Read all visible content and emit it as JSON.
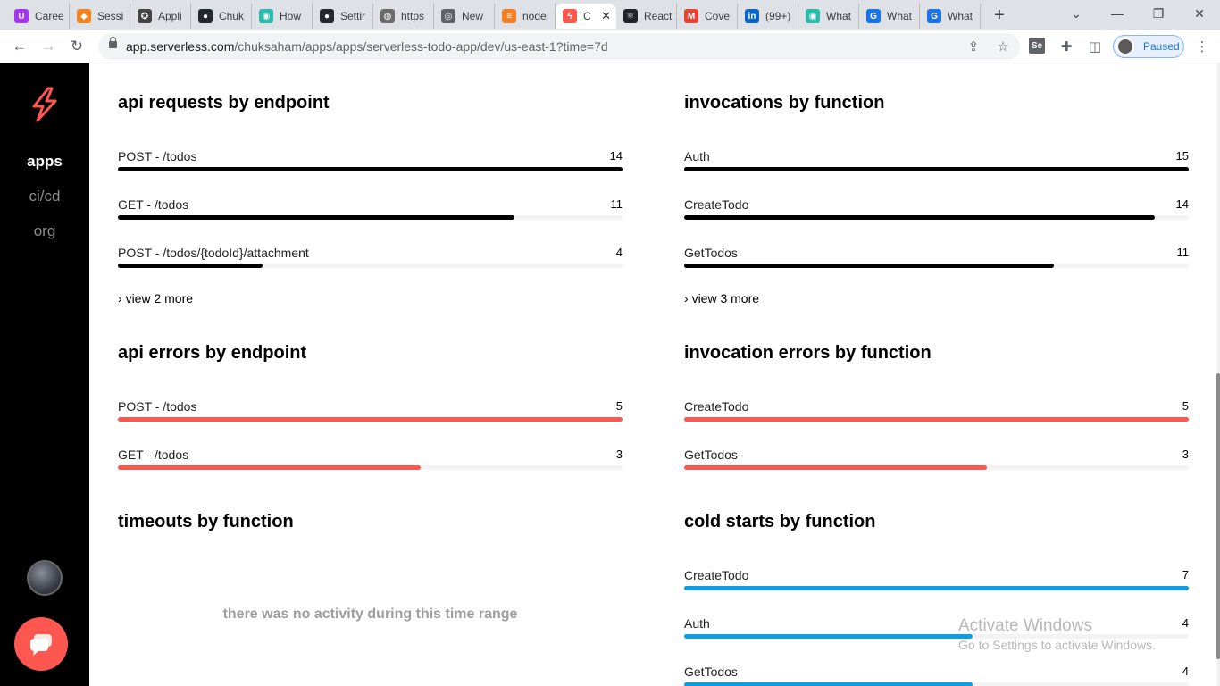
{
  "browser": {
    "tabs": [
      {
        "title": "Caree",
        "icon": "udemy-icon",
        "color": "#a435f0",
        "glyph": "U"
      },
      {
        "title": "Sessi",
        "icon": "package-icon",
        "color": "#f5821f",
        "glyph": "◆"
      },
      {
        "title": "Appli",
        "icon": "shield-app-icon",
        "color": "#444444",
        "glyph": "✪"
      },
      {
        "title": "Chuk",
        "icon": "github-icon",
        "color": "#24292e",
        "glyph": "●"
      },
      {
        "title": "How",
        "icon": "eye-icon",
        "color": "#2bbbad",
        "glyph": "◉"
      },
      {
        "title": "Settir",
        "icon": "github-icon",
        "color": "#24292e",
        "glyph": "●"
      },
      {
        "title": "https",
        "icon": "globe-icon",
        "color": "#6b6b6b",
        "glyph": "◍"
      },
      {
        "title": "New",
        "icon": "chrome-icon",
        "color": "#5f6368",
        "glyph": "◎"
      },
      {
        "title": "node",
        "icon": "stackoverflow-icon",
        "color": "#f48024",
        "glyph": "≡"
      },
      {
        "title": "C",
        "icon": "serverless-icon",
        "color": "#fd5750",
        "glyph": "ϟ",
        "active": true
      },
      {
        "title": "React",
        "icon": "react-icon",
        "color": "#20232a",
        "glyph": "⚛"
      },
      {
        "title": "Cove",
        "icon": "gmail-icon",
        "color": "#ea4335",
        "glyph": "M"
      },
      {
        "title": "(99+)",
        "icon": "linkedin-icon",
        "color": "#0a66c2",
        "glyph": "in"
      },
      {
        "title": "What",
        "icon": "eye-icon",
        "color": "#2bbbad",
        "glyph": "◉"
      },
      {
        "title": "What",
        "icon": "grammarly-icon",
        "color": "#1a73e8",
        "glyph": "G"
      },
      {
        "title": "What",
        "icon": "grammarly-icon",
        "color": "#1a73e8",
        "glyph": "G"
      }
    ],
    "new_tab": "+",
    "url_host": "app.serverless.com",
    "url_path": "/chuksaham/apps/apps/serverless-todo-app/dev/us-east-1?time=7d",
    "profile_label": "Paused"
  },
  "sidebar": {
    "items": [
      {
        "label": "apps",
        "active": true
      },
      {
        "label": "ci/cd",
        "active": false
      },
      {
        "label": "org",
        "active": false
      }
    ]
  },
  "colors": {
    "requests": "#000000",
    "errors": "#fd5750",
    "coldstarts": "#0d9ee2",
    "brand": "#fd5750"
  },
  "sections": {
    "api_requests": {
      "title": "api requests by endpoint",
      "rows": [
        {
          "label": "POST - /todos",
          "value": 14,
          "fraction": 1.0
        },
        {
          "label": "GET - /todos",
          "value": 11,
          "fraction": 0.786
        },
        {
          "label": "POST - /todos/{todoId}/attachment",
          "value": 4,
          "fraction": 0.286
        }
      ],
      "more": "view 2 more"
    },
    "invocations": {
      "title": "invocations by function",
      "rows": [
        {
          "label": "Auth",
          "value": 15,
          "fraction": 1.0
        },
        {
          "label": "CreateTodo",
          "value": 14,
          "fraction": 0.933
        },
        {
          "label": "GetTodos",
          "value": 11,
          "fraction": 0.733
        }
      ],
      "more": "view 3 more"
    },
    "api_errors": {
      "title": "api errors by endpoint",
      "rows": [
        {
          "label": "POST - /todos",
          "value": 5,
          "fraction": 1.0
        },
        {
          "label": "GET - /todos",
          "value": 3,
          "fraction": 0.6
        }
      ]
    },
    "invocation_errors": {
      "title": "invocation errors by function",
      "rows": [
        {
          "label": "CreateTodo",
          "value": 5,
          "fraction": 1.0
        },
        {
          "label": "GetTodos",
          "value": 3,
          "fraction": 0.6
        }
      ]
    },
    "timeouts": {
      "title": "timeouts by function",
      "empty": "there was no activity during this time range"
    },
    "cold_starts": {
      "title": "cold starts by function",
      "rows": [
        {
          "label": "CreateTodo",
          "value": 7,
          "fraction": 1.0
        },
        {
          "label": "Auth",
          "value": 4,
          "fraction": 0.571
        },
        {
          "label": "GetTodos",
          "value": 4,
          "fraction": 0.571
        }
      ]
    }
  },
  "watermark": {
    "line1": "Activate Windows",
    "line2": "Go to Settings to activate Windows."
  }
}
